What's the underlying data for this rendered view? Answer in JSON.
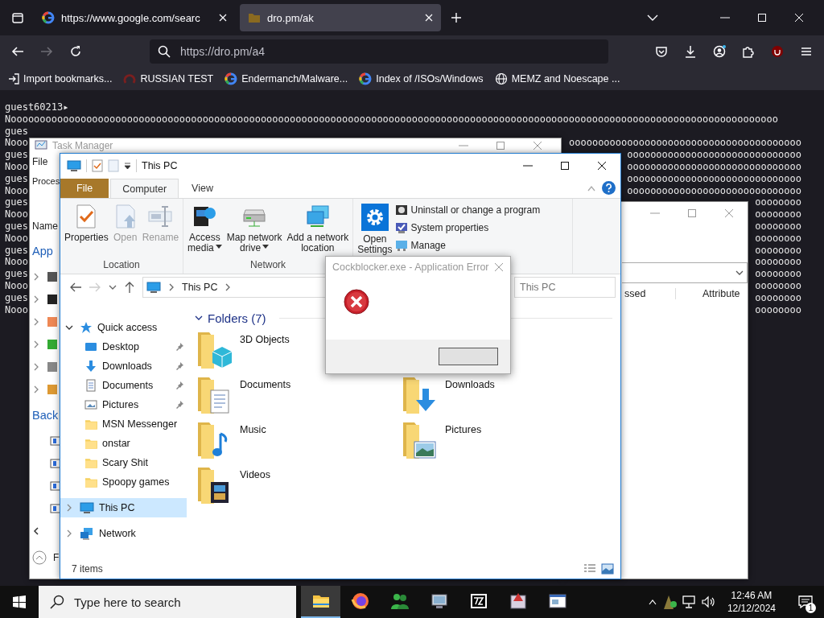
{
  "browser": {
    "tabs": [
      {
        "title": "https://www.google.com/searc",
        "kind": "google",
        "selected": false
      },
      {
        "title": "dro.pm/ak",
        "kind": "folder",
        "selected": true
      }
    ],
    "address": "https://dro.pm/a4",
    "bookmarks": [
      {
        "label": "Import bookmarks...",
        "kind": "import"
      },
      {
        "label": "RUSSIAN TEST",
        "kind": "swirl"
      },
      {
        "label": "Endermanch/Malware...",
        "kind": "google"
      },
      {
        "label": "Index of /ISOs/Windows",
        "kind": "google"
      },
      {
        "label": "MEMZ and Noescape ...",
        "kind": "globe"
      }
    ]
  },
  "terminal": {
    "lines": [
      {
        "left": "guest60213▸"
      },
      {
        "left": "Noooooooooooooooooooooooooooooooooooooooooooooooooooooooooooooooooooooooooooooooooooooooooooooooooooooooooooooooooooooooooooooooooooo"
      },
      {
        "left": "gues"
      },
      {
        "left": "Nooo",
        "right": "oooooooooooooooooooooooooooooooooooooooo"
      },
      {
        "left": "gues",
        "right": "oooooooooooooooooooooooooooooo"
      },
      {
        "left": "Nooo",
        "right": "oooooooooooooooooooooooooooooo"
      },
      {
        "left": "gues",
        "right": "oooooooooooooooooooooooooooooo"
      },
      {
        "left": "Nooo",
        "right": "oooooooooooooooooooooooooooooo"
      },
      {
        "left": "gues",
        "right": "oooooooo"
      },
      {
        "left": "Nooo",
        "right": "oooooooo"
      },
      {
        "left": "gues",
        "right": "oooooooo"
      },
      {
        "left": "Nooo",
        "right": "oooooooo"
      },
      {
        "left": "gues",
        "right": "oooooooo"
      },
      {
        "left": "Nooo",
        "right": "oooooooo"
      },
      {
        "left": "gues",
        "right": "oooooooo"
      },
      {
        "left": "Nooo",
        "right": "oooooooo"
      },
      {
        "left": "gues",
        "right": "oooooooo"
      },
      {
        "left": "Nooo",
        "right": "oooooooo"
      }
    ]
  },
  "task_manager": {
    "title": "Task Manager",
    "menu": "File",
    "tab": "Proces",
    "column": "Name",
    "apps_heading": "App",
    "background_heading": "Back",
    "footer": "F"
  },
  "back_window": {
    "columns": [
      "ssed",
      "Attribute"
    ]
  },
  "explorer": {
    "title": "This PC",
    "tabs": [
      {
        "label": "File",
        "kind": "file",
        "selected": false
      },
      {
        "label": "Computer",
        "kind": "tab",
        "selected": true
      },
      {
        "label": "View",
        "kind": "tab",
        "selected": false
      }
    ],
    "groups": [
      {
        "label": "Location",
        "buttons": [
          {
            "lines": [
              "Properties"
            ],
            "kind": "properties",
            "disabled": false,
            "dropdown": false
          },
          {
            "lines": [
              "Open"
            ],
            "kind": "open",
            "disabled": true,
            "dropdown": false
          },
          {
            "lines": [
              "Rename"
            ],
            "kind": "rename",
            "disabled": true,
            "dropdown": false
          }
        ]
      },
      {
        "label": "Network",
        "buttons": [
          {
            "lines": [
              "Access",
              "media"
            ],
            "kind": "media",
            "disabled": false,
            "dropdown": true
          },
          {
            "lines": [
              "Map network",
              "drive"
            ],
            "kind": "drive",
            "disabled": false,
            "dropdown": true
          },
          {
            "lines": [
              "Add a network",
              "location"
            ],
            "kind": "location",
            "disabled": false,
            "dropdown": false
          }
        ]
      },
      {
        "buttons": [
          {
            "lines": [
              "Open",
              "Settings"
            ],
            "kind": "settings",
            "disabled": false,
            "dropdown": false
          }
        ],
        "small": [
          {
            "label": "Uninstall or change a program",
            "kind": "uninstall"
          },
          {
            "label": "System properties",
            "kind": "sysprops"
          },
          {
            "label": "Manage",
            "kind": "manage"
          }
        ]
      }
    ],
    "breadcrumb": "This PC",
    "search_placeholder": "This PC",
    "nav": [
      {
        "label": "Quick access",
        "kind": "star",
        "expanded": true,
        "selected": false,
        "children": [
          {
            "label": "Desktop",
            "kind": "desktop",
            "pinned": true,
            "selected": false
          },
          {
            "label": "Downloads",
            "kind": "downloads",
            "pinned": true,
            "selected": false
          },
          {
            "label": "Documents",
            "kind": "documents",
            "pinned": true,
            "selected": false
          },
          {
            "label": "Pictures",
            "kind": "pictures",
            "pinned": true,
            "selected": false
          },
          {
            "label": "MSN Messenger",
            "kind": "folder",
            "pinned": false,
            "selected": false
          },
          {
            "label": "onstar",
            "kind": "folder",
            "pinned": false,
            "selected": false
          },
          {
            "label": "Scary Shit",
            "kind": "folder",
            "pinned": false,
            "selected": false
          },
          {
            "label": "Spoopy games",
            "kind": "folder",
            "pinned": false,
            "selected": false
          }
        ]
      },
      {
        "label": "This PC",
        "kind": "pc",
        "expanded": false,
        "selected": true
      },
      {
        "label": "Network",
        "kind": "network",
        "expanded": false,
        "selected": false
      }
    ],
    "folders_heading": "Folders (7)",
    "folder_columns": [
      [
        {
          "label": "3D Objects",
          "kind": "objects"
        },
        {
          "label": "Documents",
          "kind": "documents"
        },
        {
          "label": "Music",
          "kind": "music"
        },
        {
          "label": "Videos",
          "kind": "videos"
        }
      ],
      [
        {
          "label": "Downloads",
          "kind": "downloads"
        },
        {
          "label": "Pictures",
          "kind": "pictures"
        }
      ]
    ],
    "status": "7 items"
  },
  "dialog": {
    "title": "Cockblocker.exe - Application Error"
  },
  "taskbar": {
    "search_placeholder": "Type here to search",
    "apps": [
      {
        "kind": "explorer",
        "active": true
      },
      {
        "kind": "firefox",
        "active": false
      },
      {
        "kind": "messenger",
        "active": false
      },
      {
        "kind": "remote",
        "active": false
      },
      {
        "kind": "sevenzip",
        "active": false
      },
      {
        "kind": "setup",
        "active": false
      },
      {
        "kind": "window",
        "active": false
      }
    ],
    "time": "12:46 AM",
    "date": "12/12/2024",
    "notifications": "1"
  }
}
